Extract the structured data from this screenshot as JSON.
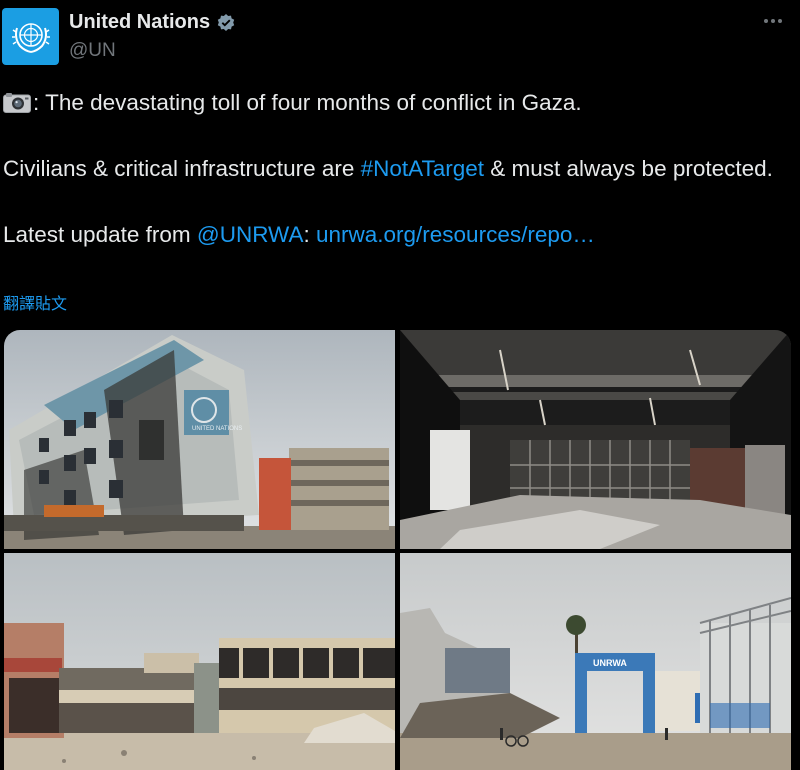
{
  "author": {
    "display_name": "United Nations",
    "handle": "@UN",
    "avatar_icon": "un-emblem-icon",
    "verified_icon": "verified-badge-icon"
  },
  "tweet": {
    "line1_text": ": The devastating toll of four months of conflict in Gaza.",
    "line2_before": "Civilians & critical infrastructure are ",
    "line2_hashtag": "#NotATarget",
    "line2_after": " & must always be protected.",
    "line3_before": "Latest update from ",
    "line3_mention": "@UNRWA",
    "line3_colon": ": ",
    "line3_link": "unrwa.org/resources/repo…"
  },
  "translate_label": "翻譯貼文",
  "media": {
    "photo1_sign": "UNITED NATIONS",
    "photo4_sign": "UNRWA"
  },
  "colors": {
    "link": "#1d9bf0",
    "avatar_bg": "#1b9ee3",
    "background": "#000000"
  }
}
